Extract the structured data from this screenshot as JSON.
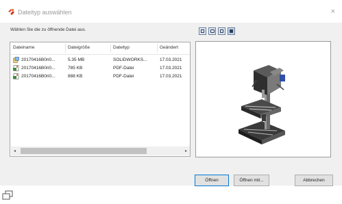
{
  "window": {
    "title": "Dateityp auswählen",
    "close_glyph": "×",
    "title_icon": "solidworks-logo-icon"
  },
  "instruction": "Wählen Sie die zu öffnende Datei aus.",
  "view_buttons": [
    "thumbnail-view-icon",
    "preview-view-icon",
    "details-view-icon",
    "list-view-icon"
  ],
  "file_list": {
    "columns": [
      "Dateiname",
      "Dateigröße",
      "Dateityp",
      "Geändert"
    ],
    "rows": [
      {
        "icon": "solidworks-file-icon",
        "name": "20170416B0ri0...",
        "size": "5.35 MB",
        "type": "SOLIDWORKS...",
        "modified": "17.03.2021"
      },
      {
        "icon": "pdf-file-icon",
        "name": "20170416B0ri0...",
        "size": "785 KB",
        "type": "PDF-Datei",
        "modified": "17.03.2021"
      },
      {
        "icon": "pdf-file-icon",
        "name": "20170416B0ri0...",
        "size": "888 KB",
        "type": "PDF-Datei",
        "modified": "17.03.2021"
      }
    ]
  },
  "scroll": {
    "left": "◂",
    "right": "▸"
  },
  "buttons": {
    "open": "Öffnen",
    "open_with": "Öffnen mit...",
    "cancel": "Abbrechen"
  },
  "colors": {
    "accent": "#0078d7",
    "logo": "#e0462a"
  }
}
